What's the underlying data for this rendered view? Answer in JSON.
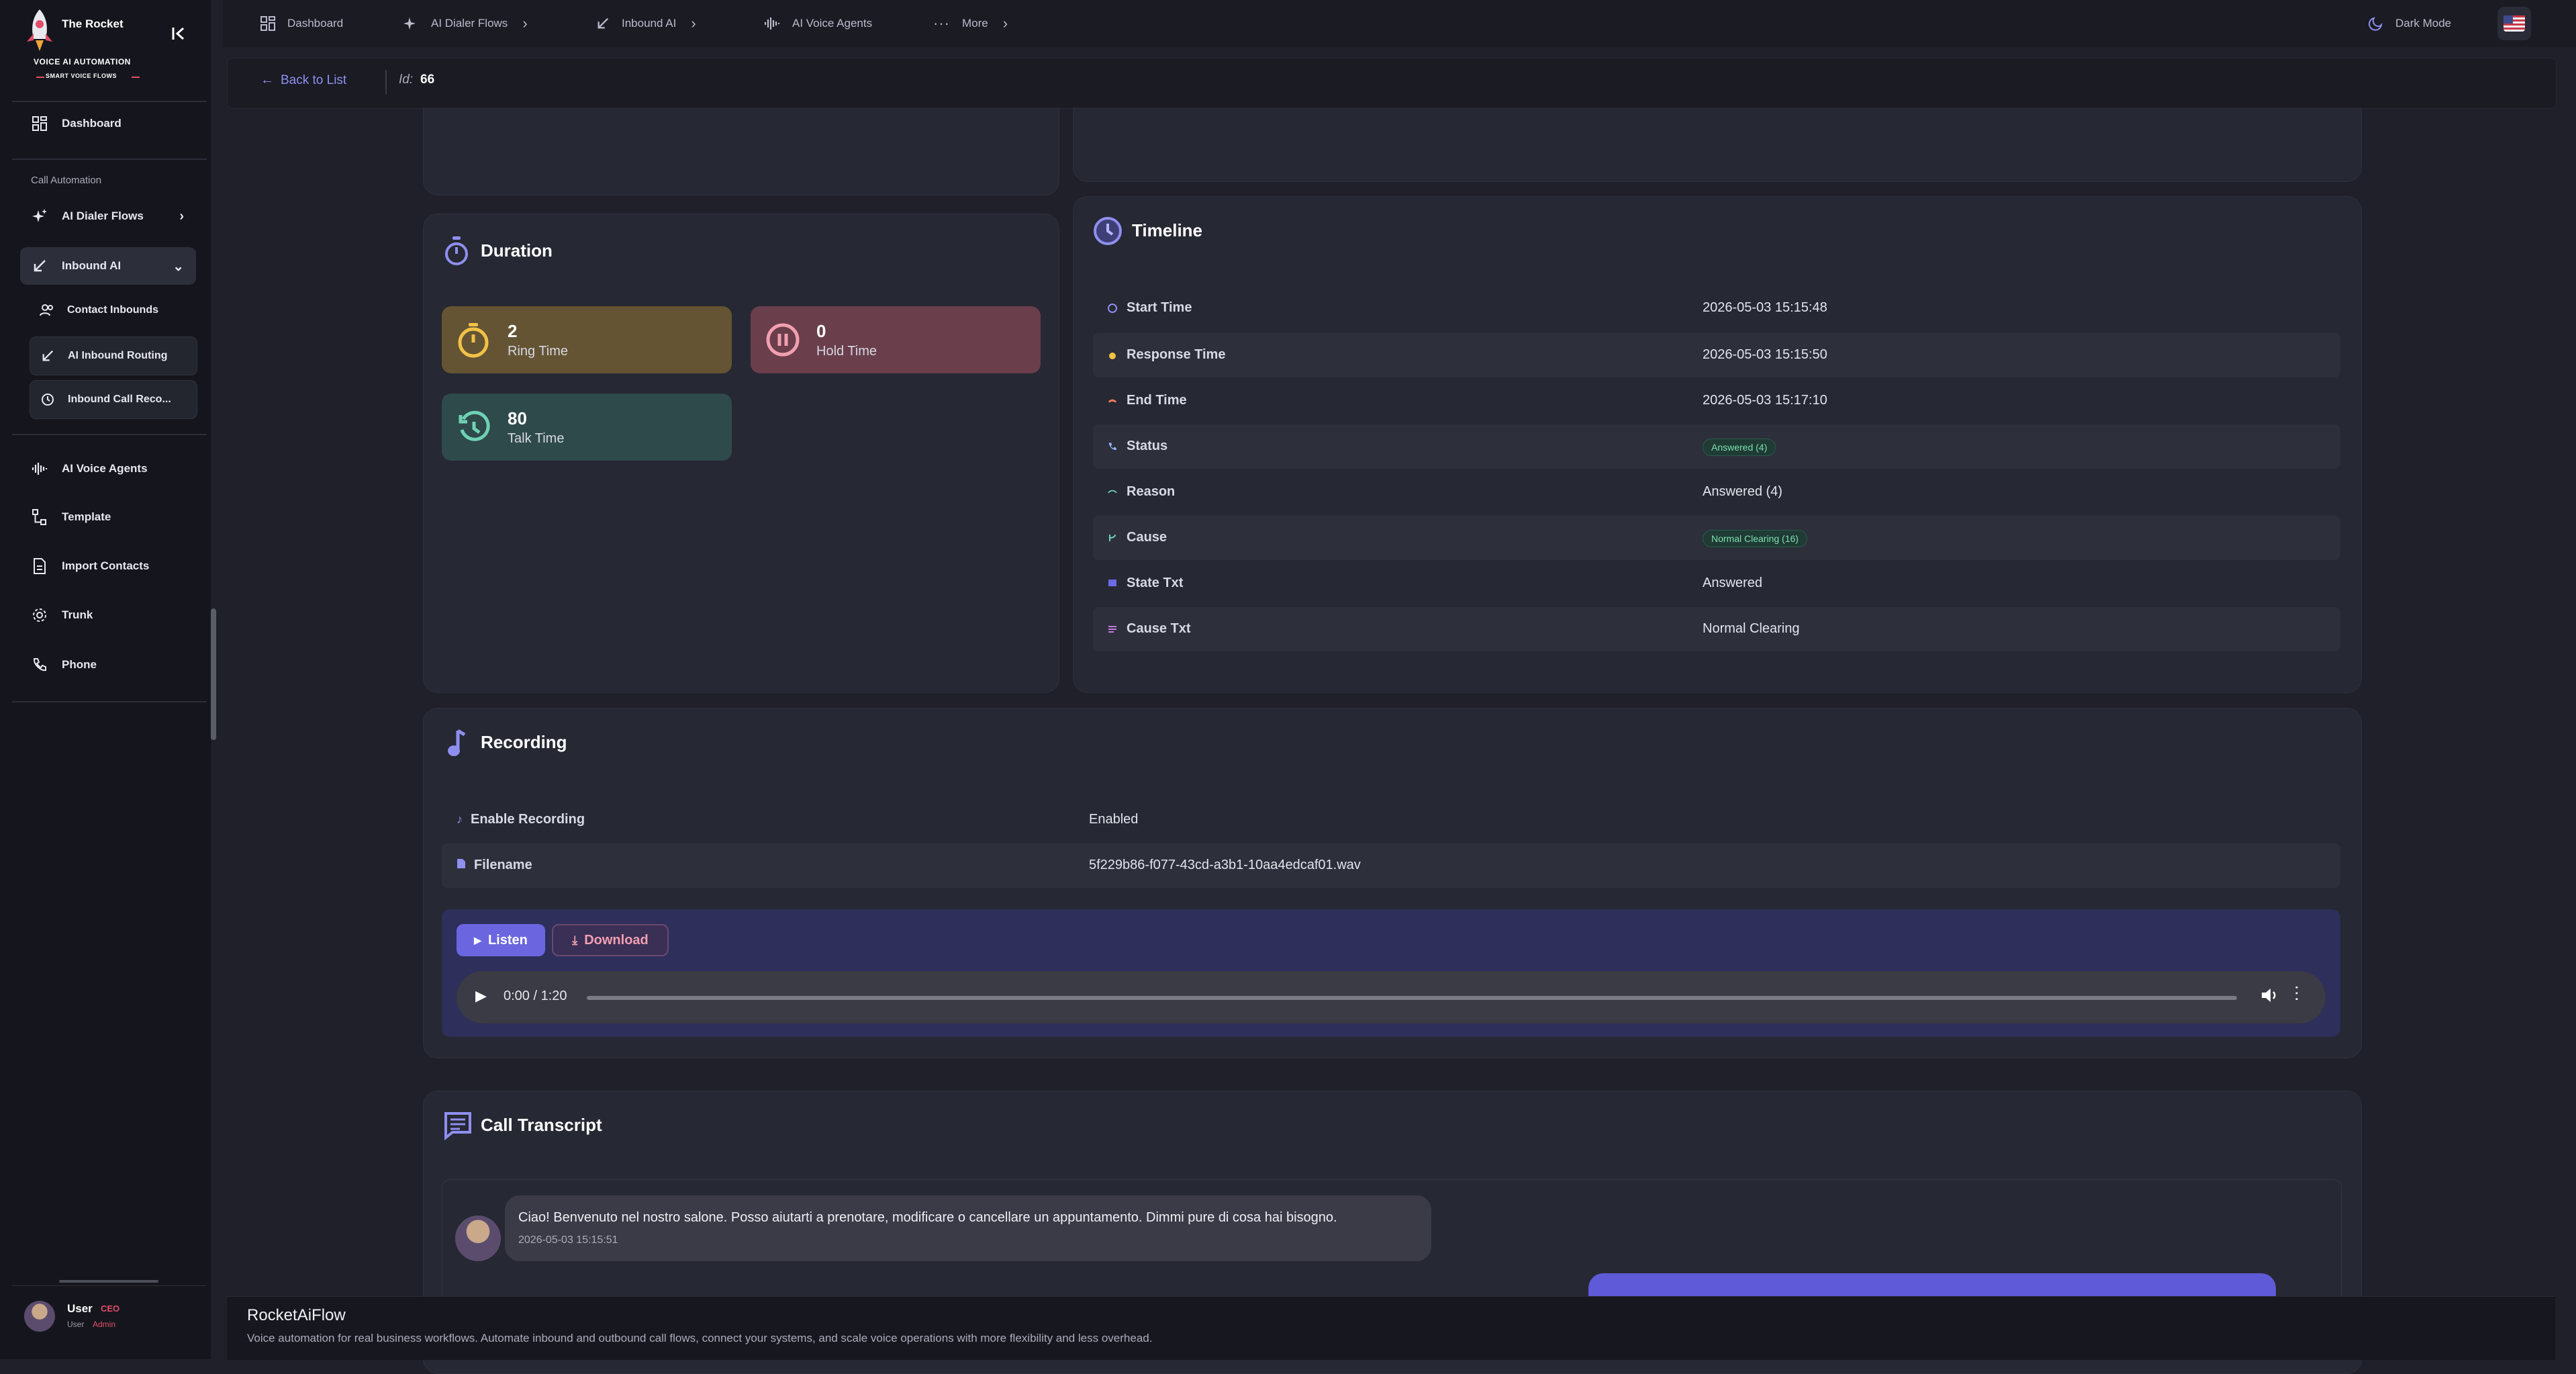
{
  "brand": {
    "title": "The Rocket",
    "tagline": "VOICE AI AUTOMATION",
    "subtagline": "SMART VOICE FLOWS"
  },
  "sidebar": {
    "dashboard": "Dashboard",
    "section_label": "Call Automation",
    "ai_dialer_flows": "AI Dialer Flows",
    "inbound_ai": "Inbound AI",
    "sub_items": [
      "Contact Inbounds",
      "AI Inbound Routing",
      "Inbound Call Reco..."
    ],
    "ai_voice_agents": "AI Voice Agents",
    "template": "Template",
    "import_contacts": "Import Contacts",
    "trunk": "Trunk",
    "phone": "Phone"
  },
  "user": {
    "name": "User",
    "badge": "CEO",
    "role_label": "User",
    "role": "Admin"
  },
  "topbar": {
    "items": [
      "Dashboard",
      "AI Dialer Flows",
      "Inbound AI",
      "AI Voice Agents",
      "More"
    ],
    "dark_mode": "Dark Mode"
  },
  "subbar": {
    "back": "Back to List",
    "id_label": "Id:",
    "id_value": "66"
  },
  "duration": {
    "title": "Duration",
    "ring": {
      "value": "2",
      "label": "Ring Time"
    },
    "hold": {
      "value": "0",
      "label": "Hold Time"
    },
    "talk": {
      "value": "80",
      "label": "Talk Time"
    }
  },
  "timeline": {
    "title": "Timeline",
    "rows": [
      {
        "key": "Start Time",
        "value": "2026-05-03 15:15:48"
      },
      {
        "key": "Response Time",
        "value": "2026-05-03 15:15:50"
      },
      {
        "key": "End Time",
        "value": "2026-05-03 15:17:10"
      },
      {
        "key": "Status",
        "value": "Answered (4)"
      },
      {
        "key": "Reason",
        "value": "Answered (4)"
      },
      {
        "key": "Cause",
        "value": "Normal Clearing (16)"
      },
      {
        "key": "State Txt",
        "value": "Answered"
      },
      {
        "key": "Cause Txt",
        "value": "Normal Clearing"
      }
    ]
  },
  "recording": {
    "title": "Recording",
    "enable_key": "Enable Recording",
    "enable_value": "Enabled",
    "filename_key": "Filename",
    "filename_value": "5f229b86-f077-43cd-a3b1-10aa4edcaf01.wav",
    "listen": "Listen",
    "download": "Download",
    "player_time": "0:00 / 1:20"
  },
  "transcript": {
    "title": "Call Transcript",
    "message": "Ciao! Benvenuto nel nostro salone. Posso aiutarti a prenotare, modificare o cancellare un appuntamento. Dimmi pure di cosa hai bisogno.",
    "timestamp": "2026-05-03 15:15:51"
  },
  "footer": {
    "title": "RocketAiFlow",
    "desc": "Voice automation for real business workflows. Automate inbound and outbound call flows, connect your systems, and scale voice operations with more flexibility and less overhead."
  }
}
